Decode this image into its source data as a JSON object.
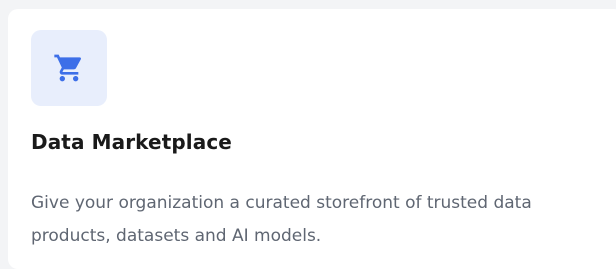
{
  "card": {
    "icon": "shopping-cart-icon",
    "accent_color": "#3d6fe8",
    "icon_bg_color": "#e8eefc",
    "title": "Data Marketplace",
    "description": "Give your organization a curated storefront of trusted data products, datasets and AI models."
  }
}
